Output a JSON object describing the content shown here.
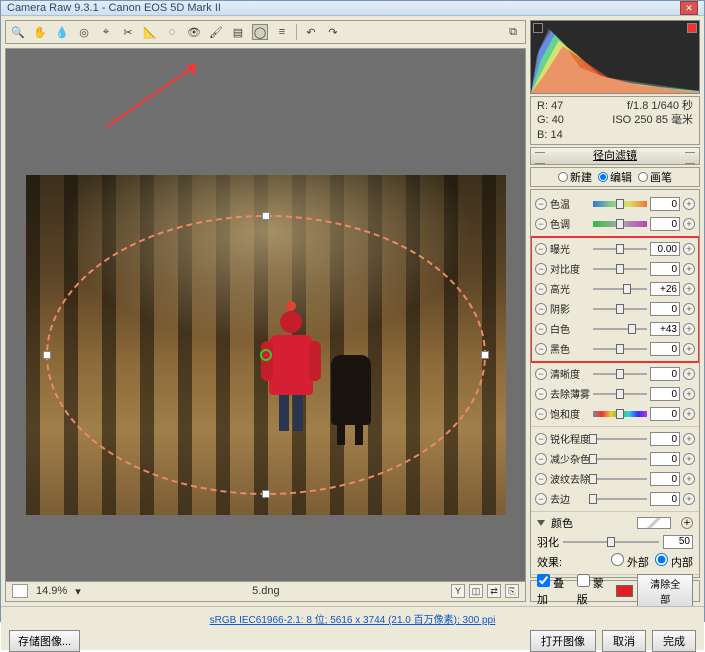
{
  "title": "Camera Raw 9.3.1  -  Canon EOS 5D Mark II",
  "toolbar_icons": [
    "zoom",
    "hand",
    "eyedropper",
    "sampler",
    "crop",
    "straighten",
    "spot",
    "redeye",
    "adjust-brush",
    "graduated",
    "radial",
    "prefs",
    "rotate-ccw",
    "rotate-cw"
  ],
  "rgb": {
    "r_label": "R:",
    "r": "47",
    "g_label": "G:",
    "g": "40",
    "b_label": "B:",
    "b": "14"
  },
  "exif": {
    "aperture": "f/1.8",
    "shutter": "1/640 秒",
    "iso_label": "ISO",
    "iso": "250",
    "focal": "85 毫米"
  },
  "panel_title": "径向滤镜",
  "modes": {
    "new": "新建",
    "edit": "编辑",
    "brush": "画笔"
  },
  "sliders": {
    "temp": {
      "label": "色温",
      "value": "0",
      "pos": 50
    },
    "tint": {
      "label": "色调",
      "value": "0",
      "pos": 50
    },
    "exposure": {
      "label": "曝光",
      "value": "0.00",
      "pos": 50
    },
    "contrast": {
      "label": "对比度",
      "value": "0",
      "pos": 50
    },
    "highlights": {
      "label": "高光",
      "value": "+26",
      "pos": 63
    },
    "shadows": {
      "label": "阴影",
      "value": "0",
      "pos": 50
    },
    "whites": {
      "label": "白色",
      "value": "+43",
      "pos": 72
    },
    "blacks": {
      "label": "黑色",
      "value": "0",
      "pos": 50
    },
    "clarity": {
      "label": "清晰度",
      "value": "0",
      "pos": 50
    },
    "dehaze": {
      "label": "去除薄雾",
      "value": "0",
      "pos": 50
    },
    "saturation": {
      "label": "饱和度",
      "value": "0",
      "pos": 50
    },
    "sharpness": {
      "label": "锐化程度",
      "value": "0",
      "pos": 0
    },
    "noise": {
      "label": "减少杂色",
      "value": "0",
      "pos": 0
    },
    "moire": {
      "label": "波纹去除",
      "value": "0",
      "pos": 0
    },
    "defringe": {
      "label": "去边",
      "value": "0",
      "pos": 0
    }
  },
  "color_section": {
    "label": "颜色"
  },
  "feather": {
    "label": "羽化",
    "value": "50"
  },
  "effect": {
    "label": "效果:",
    "outside": "外部",
    "inside": "内部"
  },
  "overlay": {
    "overlay": "叠加",
    "mask": "蒙版",
    "clear": "清除全部"
  },
  "status": {
    "zoom": "14.9%",
    "filename": "5.dng"
  },
  "footer": {
    "link": "sRGB IEC61966-2.1: 8 位; 5616 x 3744 (21.0 百万像素); 300 ppi",
    "save": "存储图像...",
    "open": "打开图像",
    "cancel": "取消",
    "done": "完成"
  }
}
